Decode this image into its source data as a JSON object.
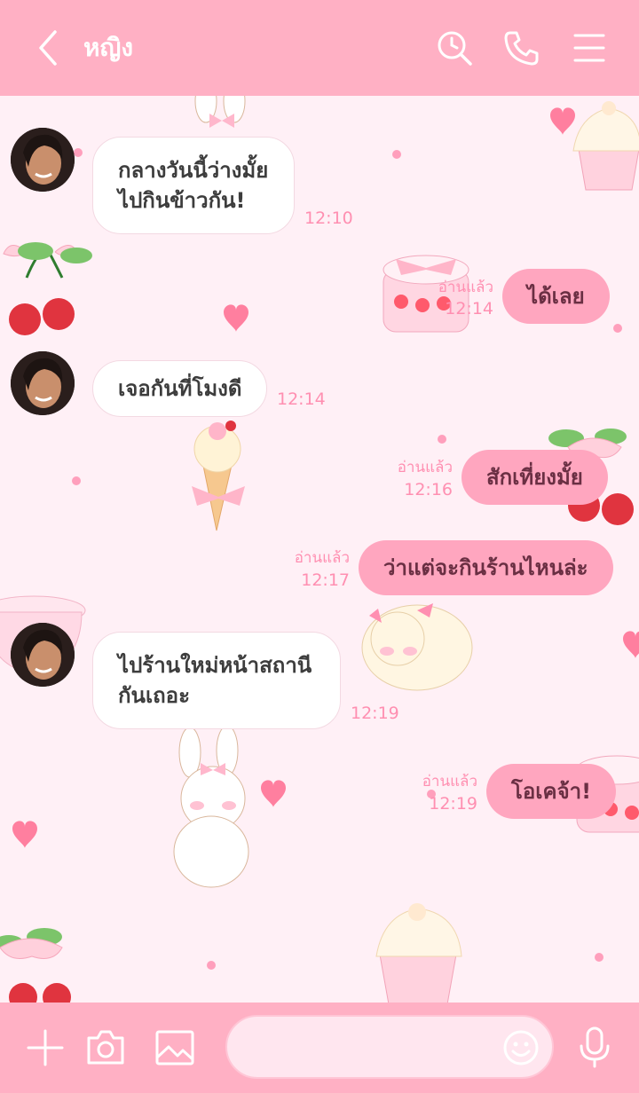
{
  "header": {
    "title": "หญิง",
    "icons": [
      "back-chevron-icon",
      "search-clock-icon",
      "phone-icon",
      "menu-icon"
    ]
  },
  "messages": [
    {
      "side": "in",
      "lines": [
        "กลางวันนี้ว่างมั้ย",
        "ไปกินข้าวกัน!"
      ],
      "time": "12:10"
    },
    {
      "side": "out",
      "lines": [
        "ได้เลย"
      ],
      "read": "อ่านแล้ว",
      "time": "12:14"
    },
    {
      "side": "in",
      "lines": [
        "เจอกันที่โมงดี"
      ],
      "time": "12:14"
    },
    {
      "side": "out",
      "lines": [
        "สักเที่ยงมั้ย"
      ],
      "read": "อ่านแล้ว",
      "time": "12:16"
    },
    {
      "side": "out",
      "lines": [
        "ว่าแต่จะกินร้านไหนล่ะ"
      ],
      "read": "อ่านแล้ว",
      "time": "12:17"
    },
    {
      "side": "in",
      "lines": [
        "ไปร้านใหม่หน้าสถานี",
        "กันเถอะ"
      ],
      "time": "12:19"
    },
    {
      "side": "out",
      "lines": [
        "โอเคจ้า!"
      ],
      "read": "อ่านแล้ว",
      "time": "12:19"
    }
  ],
  "footer": {
    "icons": [
      "plus-icon",
      "camera-icon",
      "image-icon",
      "emoji-icon",
      "microphone-icon"
    ],
    "input_placeholder": ""
  },
  "colors": {
    "header_bg": "#ffb0c4",
    "chat_bg": "#fff0f6",
    "out_bubble": "#ffa6bf",
    "in_bubble": "#ffffff",
    "time_text": "#ff8fb1"
  }
}
